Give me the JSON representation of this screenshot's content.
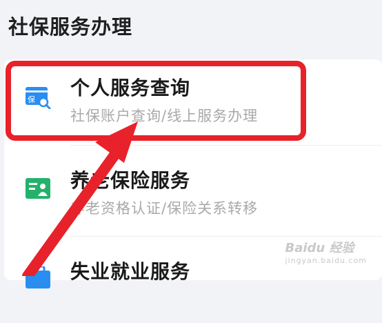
{
  "section": {
    "title": "社保服务办理"
  },
  "services": [
    {
      "title": "个人服务查询",
      "subtitle": "社保账户查询/线上服务办理",
      "icon": "insurance-search-icon",
      "icon_text": "保",
      "icon_color": "#2a8ef0"
    },
    {
      "title": "养老保险服务",
      "subtitle": "养老资格认证/保险关系转移",
      "icon": "id-card-icon",
      "icon_color": "#24b26a"
    },
    {
      "title": "失业就业服务",
      "subtitle": "",
      "icon": "briefcase-icon",
      "icon_color": "#2a8ef0"
    }
  ],
  "annotation": {
    "highlight_color": "#e8222b"
  },
  "watermark": {
    "text": "Baidu 经验",
    "sub": "jingyan.baidu.com"
  }
}
